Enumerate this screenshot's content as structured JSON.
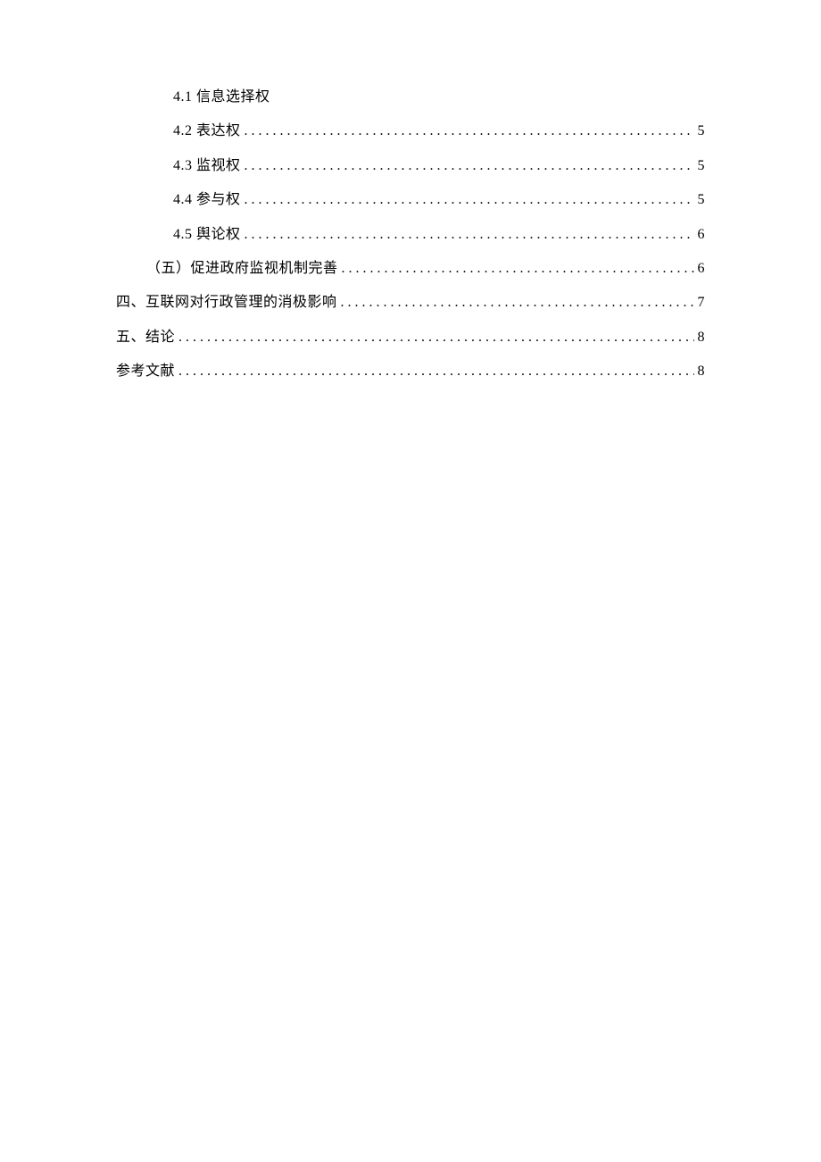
{
  "toc": [
    {
      "label": "4.1 信息选择权",
      "page": "",
      "indent": 3,
      "noPage": true
    },
    {
      "label": "4.2 表达权",
      "page": "5",
      "indent": 3,
      "noPage": false
    },
    {
      "label": "4.3 监视权",
      "page": "5",
      "indent": 3,
      "noPage": false
    },
    {
      "label": "4.4 参与权",
      "page": "5",
      "indent": 3,
      "noPage": false
    },
    {
      "label": "4.5 舆论权",
      "page": "6",
      "indent": 3,
      "noPage": false
    },
    {
      "label": "（五）促进政府监视机制完善",
      "page": "6",
      "indent": 2,
      "noPage": false
    },
    {
      "label": "四、互联网对行政管理的消极影响",
      "page": "7",
      "indent": 1,
      "noPage": false
    },
    {
      "label": "五、结论",
      "page": "8",
      "indent": 1,
      "noPage": false
    },
    {
      "label": "参考文献",
      "page": "8",
      "indent": 1,
      "noPage": false
    }
  ]
}
